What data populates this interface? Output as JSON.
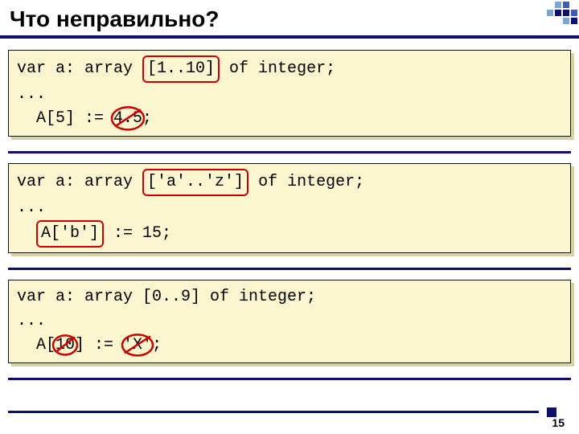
{
  "title": "Что неправильно?",
  "page_number": "15",
  "code_block_1": {
    "be_var": "var a: array ",
    "index_range": "[1..10]",
    "after_range": " of integer;",
    "ellipsis": "...",
    "assign_prefix": "  A[5] := ",
    "bad_value": "4.5",
    "assign_suffix": ";"
  },
  "code_block_2": {
    "be_var": "var a: array ",
    "index_range": "['a'..'z']",
    "after_range": " of integer;",
    "ellipsis": "...",
    "assign_prefix": "  ",
    "array_ref": "A['b']",
    "assign_rest": " := 15;"
  },
  "code_block_3": {
    "decl": "var a: array [0..9] of integer;",
    "ellipsis": "...",
    "pre": "  A[",
    "bad_index": "10",
    "mid": "] := ",
    "bad_value": "'X'",
    "post": ";"
  },
  "corner_colors": [
    "#fff",
    "#7aa6cf",
    "#3e5db0",
    "#fff",
    "#7aa6cf",
    "#0e0f6f",
    "#0e0f6f",
    "#3e5db0",
    "#fff",
    "#fff",
    "#7aa6cf",
    "#0e0f6f"
  ]
}
